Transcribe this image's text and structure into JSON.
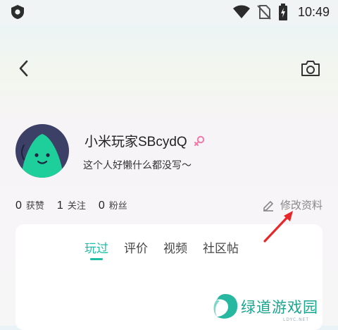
{
  "status_bar": {
    "time": "10:49",
    "icons": [
      "app-shield-icon",
      "wifi-icon",
      "no-sim-icon",
      "battery-charging-icon"
    ]
  },
  "topbar": {
    "back_icon": "chevron-left-icon",
    "camera_icon": "camera-icon"
  },
  "profile": {
    "username": "小米玩家SBcydQ",
    "gender_icon": "female-icon",
    "bio": "这个人好懒什么都没写～",
    "avatar_icon": "green-blob-avatar"
  },
  "stats": [
    {
      "count": "0",
      "label": "获赞"
    },
    {
      "count": "1",
      "label": "关注"
    },
    {
      "count": "0",
      "label": "粉丝"
    }
  ],
  "edit_profile": {
    "label": "修改资料",
    "icon": "pencil-icon"
  },
  "tabs": [
    {
      "label": "玩过",
      "active": true
    },
    {
      "label": "评价",
      "active": false
    },
    {
      "label": "视频",
      "active": false
    },
    {
      "label": "社区帖",
      "active": false
    }
  ],
  "watermark": {
    "text": "绿道游戏园",
    "sub": "LDYC.NET"
  },
  "colors": {
    "accent": "#1bbfa8",
    "annotation_arrow": "#e8262a",
    "avatar_bg": "#3c4066",
    "avatar_blob": "#1ecf9b"
  }
}
